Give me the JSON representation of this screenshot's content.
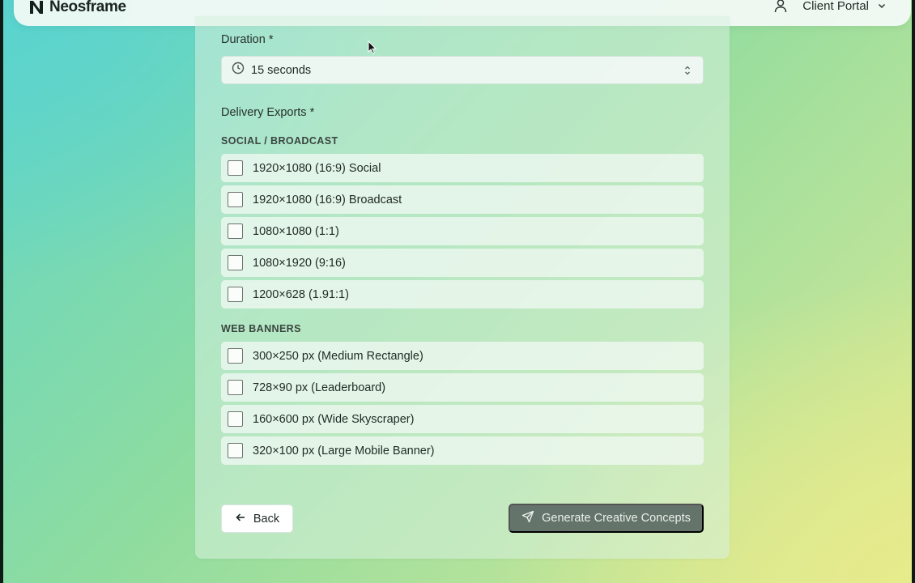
{
  "header": {
    "brand": "Neosframe",
    "account_label": "Client Portal",
    "icons": {
      "user": "user-icon",
      "chevron": "chevron-down-icon"
    }
  },
  "form": {
    "duration": {
      "label": "Duration *",
      "value": "15 seconds",
      "icons": {
        "leading": "clock-icon",
        "trailing": "chevrons-up-down-icon"
      }
    },
    "exports": {
      "label": "Delivery Exports *",
      "groups": [
        {
          "title": "SOCIAL / BROADCAST",
          "options": [
            {
              "label": "1920×1080 (16:9) Social",
              "checked": false
            },
            {
              "label": "1920×1080 (16:9) Broadcast",
              "checked": false
            },
            {
              "label": "1080×1080 (1:1)",
              "checked": false
            },
            {
              "label": "1080×1920 (9:16)",
              "checked": false
            },
            {
              "label": "1200×628 (1.91:1)",
              "checked": false
            }
          ]
        },
        {
          "title": "WEB BANNERS",
          "options": [
            {
              "label": "300×250 px (Medium Rectangle)",
              "checked": false
            },
            {
              "label": "728×90 px (Leaderboard)",
              "checked": false
            },
            {
              "label": "160×600 px (Wide Skyscraper)",
              "checked": false
            },
            {
              "label": "320×100 px (Large Mobile Banner)",
              "checked": false
            }
          ]
        }
      ]
    },
    "actions": {
      "back": {
        "label": "Back",
        "icon": "arrow-left-icon"
      },
      "generate": {
        "label": "Generate Creative Concepts",
        "icon": "send-icon"
      }
    }
  },
  "colors": {
    "primary_button": "#64746a",
    "background_start": "#5ad3cf",
    "background_end": "#e6eb8c"
  }
}
